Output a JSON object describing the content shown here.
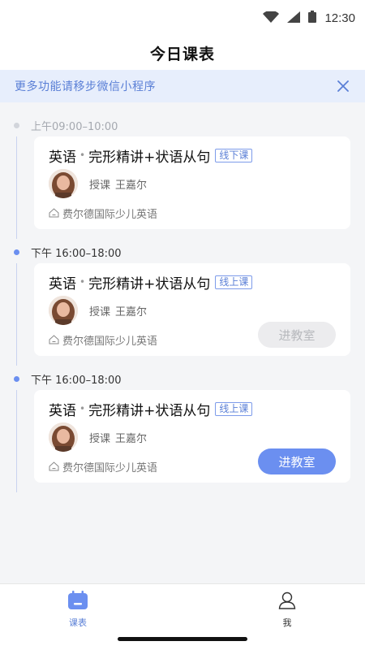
{
  "status_bar": {
    "time": "12:30"
  },
  "header": {
    "title": "今日课表"
  },
  "banner": {
    "text": "更多功能请移步微信小程序"
  },
  "colors": {
    "accent": "#6b8ff0",
    "badge_text": "#5a7fd6",
    "banner_bg": "#e7eefc"
  },
  "slots": [
    {
      "time": "上午09:00–10:00",
      "subject": "英语",
      "separator": "•",
      "course": "完形精讲+状语从句",
      "mode": "线下课",
      "teacher_label": "授课",
      "teacher_name": "王嘉尔",
      "school": "费尔德国际少儿英语",
      "button": null
    },
    {
      "time": "下午  16:00–18:00",
      "subject": "英语",
      "separator": "•",
      "course": "完形精讲+状语从句",
      "mode": "线上课",
      "teacher_label": "授课",
      "teacher_name": "王嘉尔",
      "school": "费尔德国际少儿英语",
      "button": "进教室"
    },
    {
      "time": "下午  16:00–18:00",
      "subject": "英语",
      "separator": "•",
      "course": "完形精讲+状语从句",
      "mode": "线上课",
      "teacher_label": "授课",
      "teacher_name": "王嘉尔",
      "school": "费尔德国际少儿英语",
      "button": "进教室"
    }
  ],
  "bottom_nav": {
    "schedule_label": "课表",
    "me_label": "我"
  },
  "icons": [
    "wifi-icon",
    "signal-icon",
    "battery-icon",
    "close-icon",
    "home-icon",
    "calendar-icon",
    "user-icon"
  ]
}
